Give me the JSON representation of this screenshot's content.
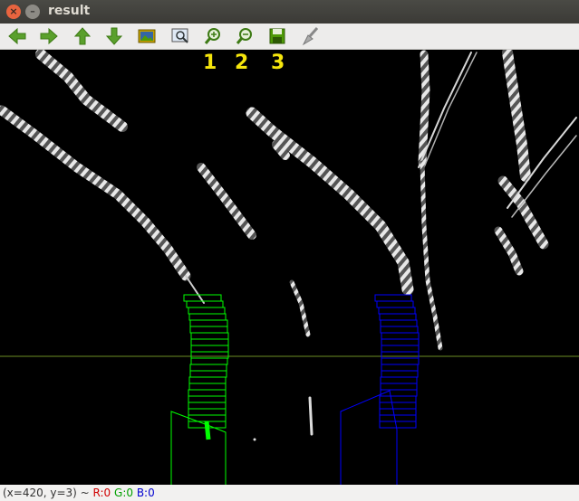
{
  "window": {
    "title": "result"
  },
  "toolbar": {
    "buttons": [
      {
        "name": "pan-left",
        "icon": "arrow-left-icon",
        "color": "#4e9a06"
      },
      {
        "name": "pan-right",
        "icon": "arrow-right-icon",
        "color": "#4e9a06"
      },
      {
        "name": "pan-up",
        "icon": "arrow-up-icon",
        "color": "#4e9a06"
      },
      {
        "name": "pan-down",
        "icon": "arrow-down-icon",
        "color": "#4e9a06"
      },
      {
        "name": "zoom-original",
        "icon": "image-icon"
      },
      {
        "name": "zoom-fit",
        "icon": "zoom-fit-icon"
      },
      {
        "name": "zoom-in",
        "icon": "zoom-in-icon",
        "color": "#4e9a06"
      },
      {
        "name": "zoom-out",
        "icon": "zoom-out-icon",
        "color": "#4e9a06"
      },
      {
        "name": "save",
        "icon": "save-icon",
        "color": "#4e9a06"
      },
      {
        "name": "properties",
        "icon": "brush-icon"
      }
    ]
  },
  "annotations": {
    "label1": "1",
    "label2": "2",
    "label3": "3",
    "color": "#f5e50c"
  },
  "image": {
    "background": "#000000",
    "horizon_color": "#6b8e23",
    "left_lane_color": "#00ff00",
    "right_lane_color": "#0000ff"
  },
  "status": {
    "coords": "(x=420, y=3) ~ ",
    "r": "R:0",
    "g": "G:0",
    "b": "B:0"
  }
}
